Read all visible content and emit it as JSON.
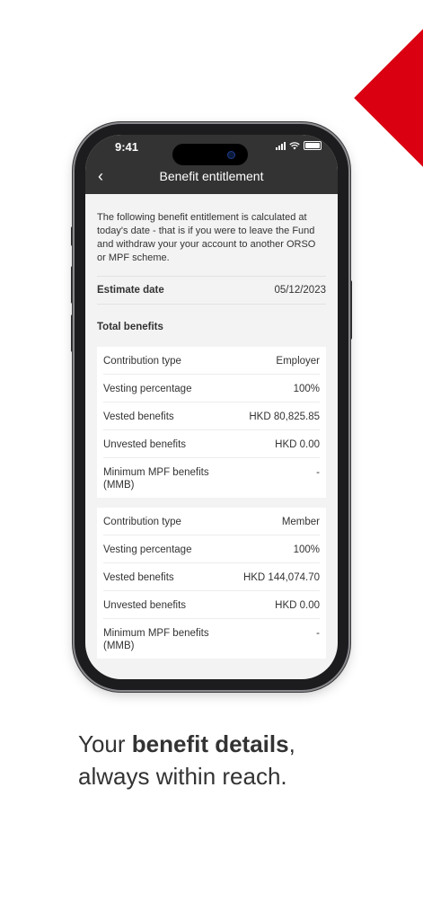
{
  "status": {
    "time": "9:41"
  },
  "header": {
    "title": "Benefit entitlement",
    "back_icon": "chevron-left-icon"
  },
  "intro": "The following benefit entitlement is calculated at today's date - that is if you were to leave the Fund and withdraw your your account to another ORSO or MPF scheme.",
  "estimate": {
    "label": "Estimate date",
    "value": "05/12/2023"
  },
  "total_benefits_title": "Total benefits",
  "cards": [
    {
      "rows": [
        {
          "label": "Contribution type",
          "value": "Employer"
        },
        {
          "label": "Vesting percentage",
          "value": "100%"
        },
        {
          "label": "Vested benefits",
          "value": "HKD 80,825.85"
        },
        {
          "label": "Unvested benefits",
          "value": "HKD 0.00"
        },
        {
          "label": "Minimum MPF benefits (MMB)",
          "value": "-"
        }
      ]
    },
    {
      "rows": [
        {
          "label": "Contribution type",
          "value": "Member"
        },
        {
          "label": "Vesting percentage",
          "value": "100%"
        },
        {
          "label": "Vested benefits",
          "value": "HKD 144,074.70"
        },
        {
          "label": "Unvested benefits",
          "value": "HKD 0.00"
        },
        {
          "label": "Minimum MPF benefits (MMB)",
          "value": "-"
        }
      ]
    }
  ],
  "tagline": {
    "part1": "Your ",
    "bold": "benefit details",
    "part2": ",",
    "line2": "always within reach."
  },
  "colors": {
    "brand_red": "#db0011",
    "header_bg": "#333333"
  }
}
